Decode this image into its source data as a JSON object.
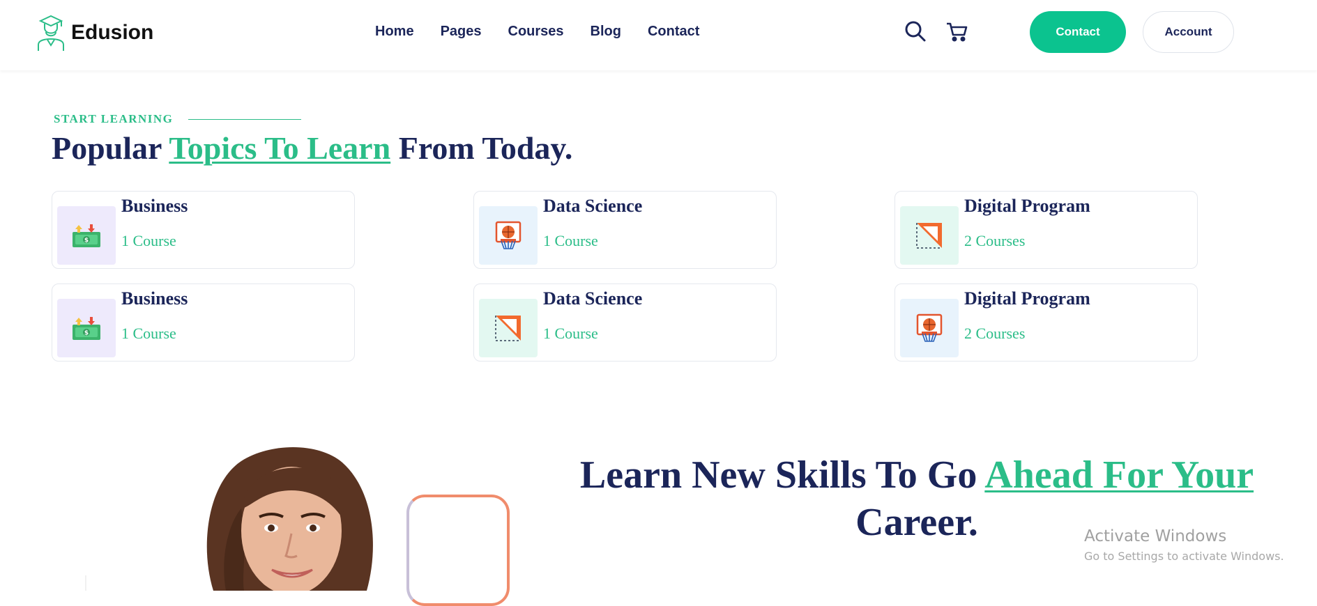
{
  "brand": {
    "name": "Edusion",
    "logo_icon": "graduate-student-icon",
    "accent": "#0bc38f"
  },
  "nav": {
    "items": [
      "Home",
      "Pages",
      "Courses",
      "Blog",
      "Contact"
    ]
  },
  "header_actions": {
    "search_icon": "search-icon",
    "cart_icon": "cart-icon",
    "contact_label": "Contact",
    "account_label": "Account"
  },
  "topics": {
    "eyebrow": "START LEARNING",
    "title_start": "Popular ",
    "title_highlight": "Topics To Learn",
    "title_end": " From Today.",
    "cards": [
      {
        "title": "Business",
        "count": "1 Course",
        "icon": "money-icon",
        "bg": "#eeeafc"
      },
      {
        "title": "Data Science",
        "count": "1 Course",
        "icon": "basketball-hoop-icon",
        "bg": "#e8f3fc"
      },
      {
        "title": "Digital Program",
        "count": "2 Courses",
        "icon": "set-square-icon",
        "bg": "#e3f8f1"
      },
      {
        "title": "Business",
        "count": "1 Course",
        "icon": "money-icon",
        "bg": "#eeeafc"
      },
      {
        "title": "Data Science",
        "count": "1 Course",
        "icon": "set-square-icon",
        "bg": "#e3f8f1"
      },
      {
        "title": "Digital Program",
        "count": "2 Courses",
        "icon": "basketball-hoop-icon",
        "bg": "#e8f3fc"
      }
    ]
  },
  "skills": {
    "title_start": "Learn New Skills To Go ",
    "title_highlight": "Ahead For Your",
    "title_end": "Career."
  },
  "watermark": {
    "line1": "Activate Windows",
    "line2": "Go to Settings to activate Windows."
  }
}
